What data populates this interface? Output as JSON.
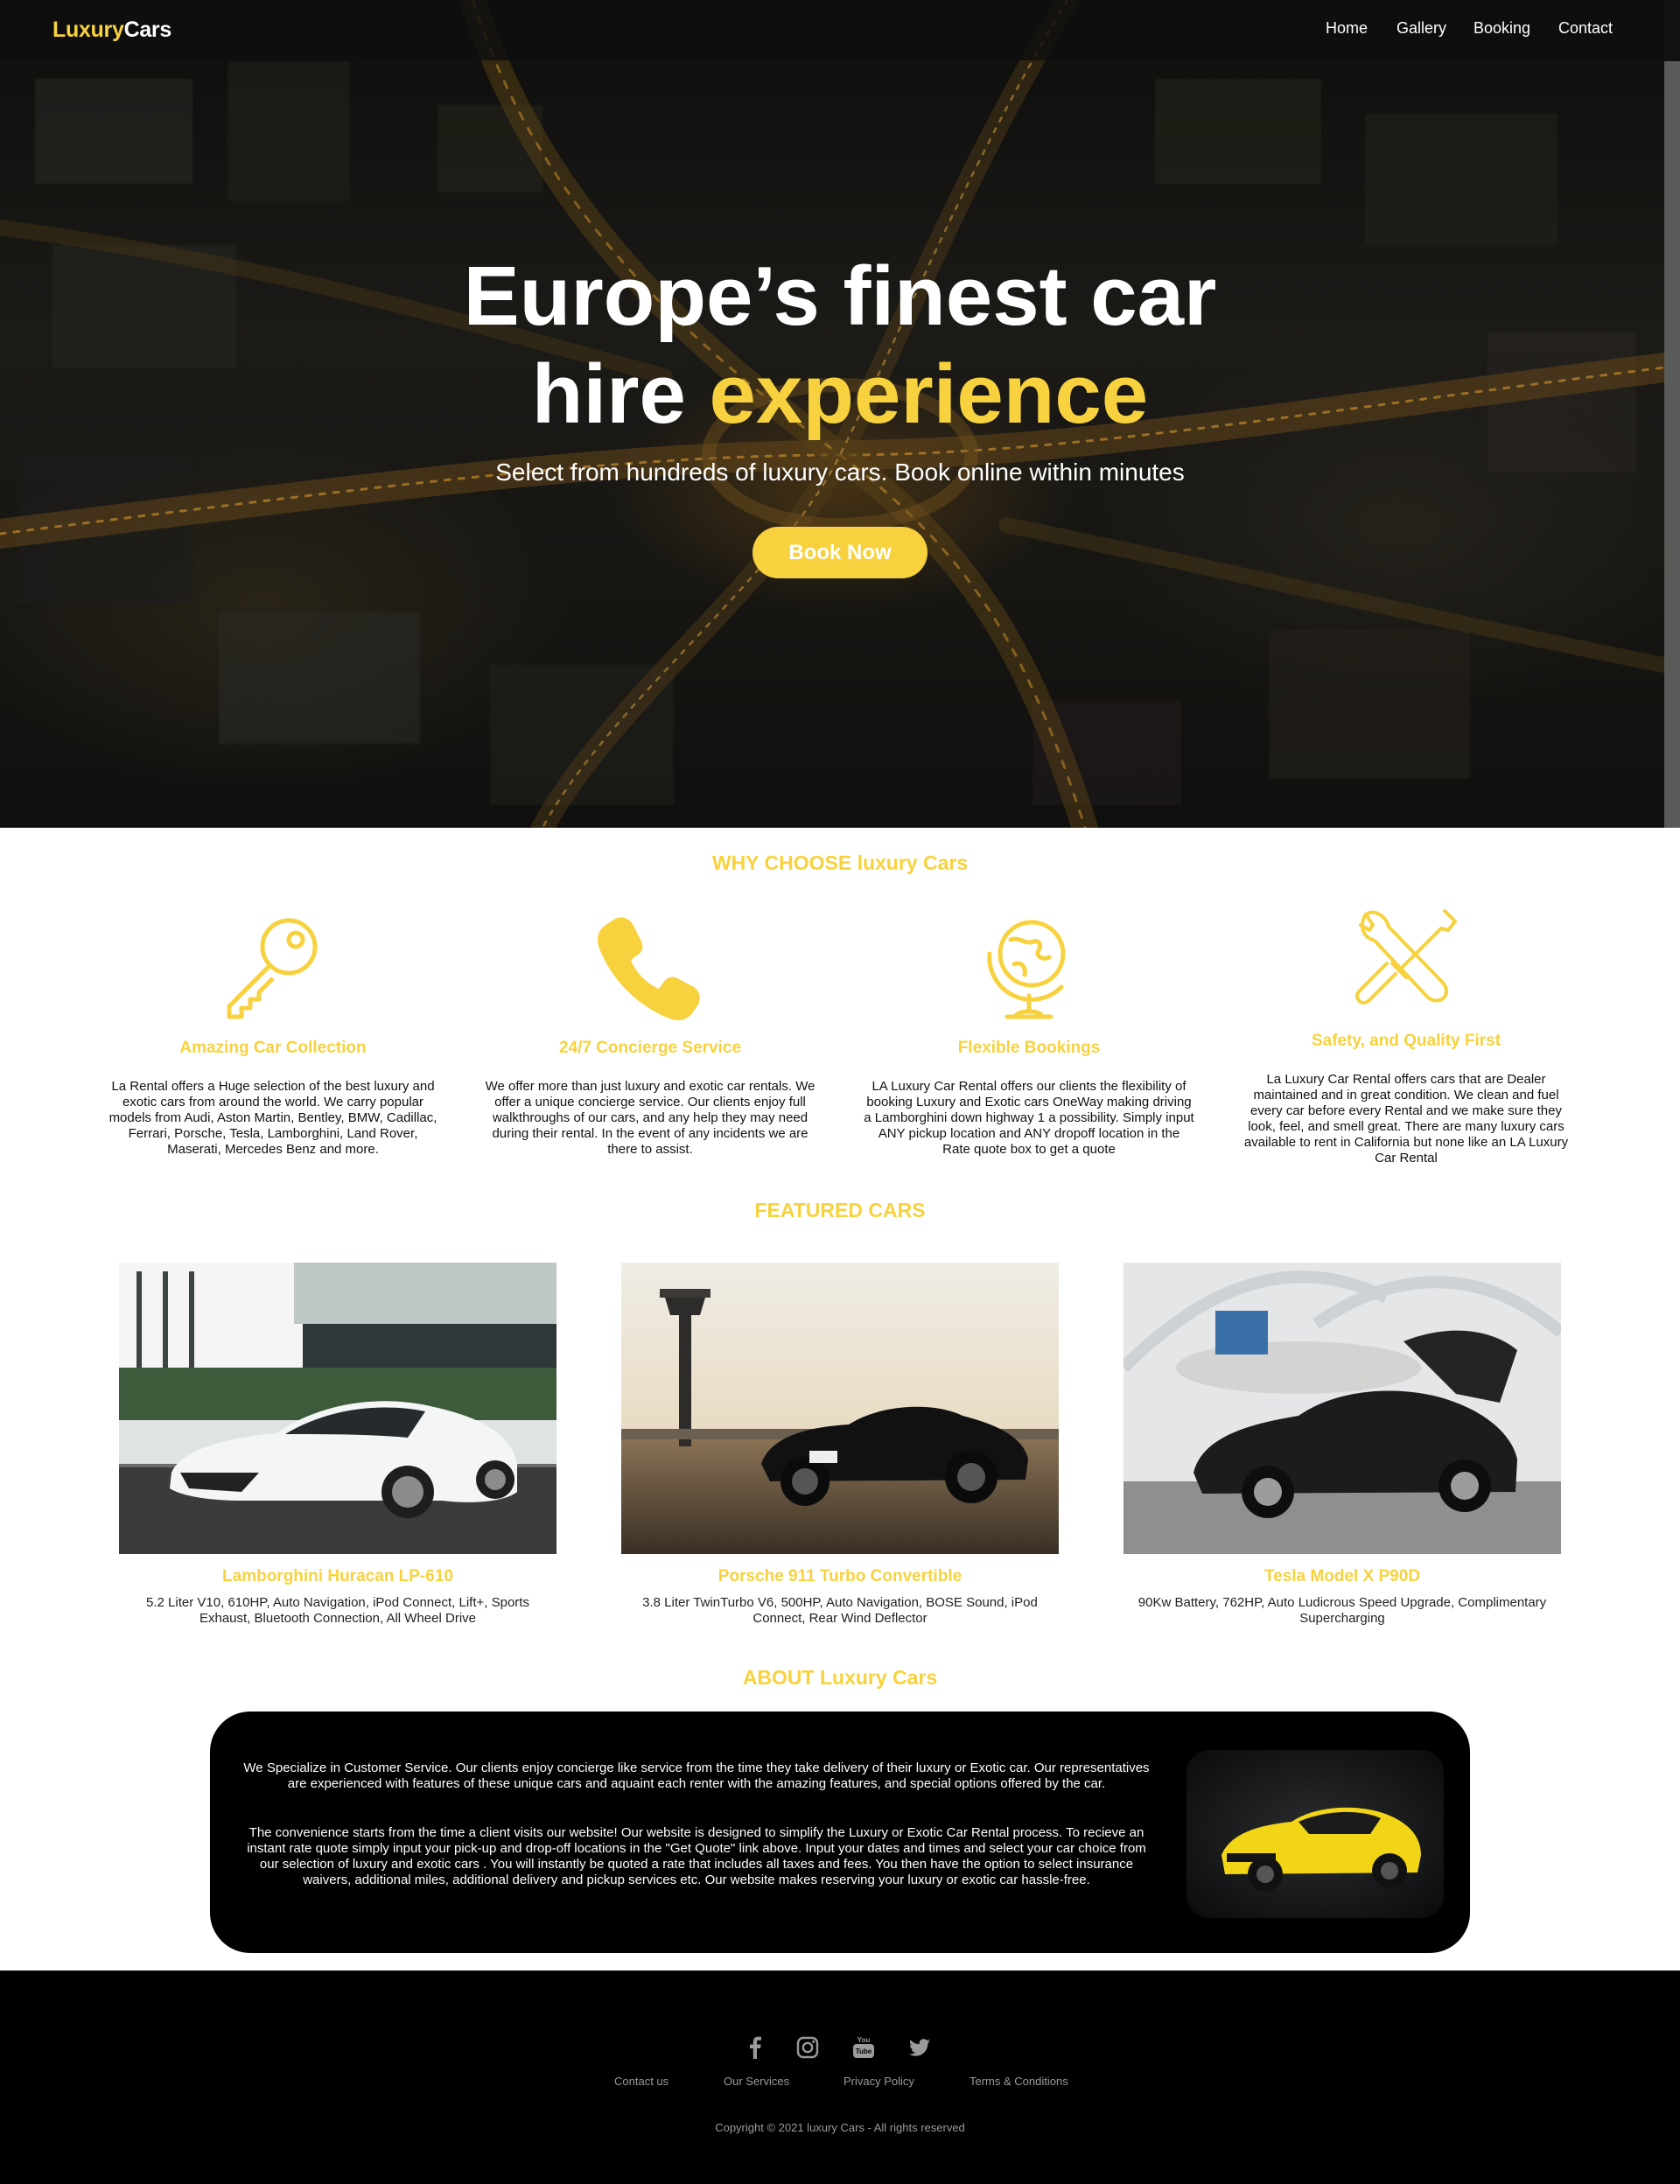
{
  "brand": {
    "part1": "Luxury",
    "part2": "Cars"
  },
  "nav": [
    {
      "label": "Home"
    },
    {
      "label": "Gallery"
    },
    {
      "label": "Booking"
    },
    {
      "label": "Contact"
    }
  ],
  "hero": {
    "line1": "Europe’s finest car",
    "line2_plain": "hire ",
    "line2_highlight": "experience",
    "subtitle": "Select from hundreds of luxury cars. Book online within minutes",
    "cta": "Book Now"
  },
  "why": {
    "title": "WHY CHOOSE luxury Cars",
    "features": [
      {
        "icon": "key-icon",
        "title": "Amazing Car Collection",
        "text": "La Rental offers a Huge selection of the best luxury and exotic cars from around the world. We carry popular models from Audi, Aston Martin, Bentley, BMW, Cadillac, Ferrari, Porsche, Tesla, Lamborghini, Land Rover, Maserati, Mercedes Benz and more."
      },
      {
        "icon": "phone-icon",
        "title": "24/7 Concierge Service",
        "text": "We offer more than just luxury and exotic car rentals. We offer a unique concierge service. Our clients enjoy full walkthroughs of our cars, and any help they may need during their rental. In the event of any incidents we are there to assist."
      },
      {
        "icon": "globe-icon",
        "title": "Flexible Bookings",
        "text": "LA Luxury Car Rental offers our clients the flexibility of booking Luxury and Exotic cars OneWay making driving a Lamborghini down highway 1 a possibility. Simply input ANY pickup location and ANY dropoff location in the Rate quote box to get a quote"
      },
      {
        "icon": "tools-icon",
        "title": "Safety, and Quality First",
        "text": "La Luxury Car Rental offers cars that are Dealer maintained and in great condition. We clean and fuel every car before every Rental and we make sure they look, feel, and smell great. There are many luxury cars available to rent in California but none like an LA Luxury Car Rental"
      }
    ]
  },
  "featured": {
    "title": "FEATURED CARS",
    "cars": [
      {
        "name": "Lamborghini Huracan LP-610",
        "specs": "5.2 Liter V10, 610HP, Auto Navigation, iPod Connect, Lift+, Sports Exhaust, Bluetooth Connection, All Wheel Drive"
      },
      {
        "name": "Porsche 911 Turbo Convertible",
        "specs": "3.8 Liter TwinTurbo V6, 500HP, Auto Navigation, BOSE Sound, iPod Connect, Rear Wind Deflector"
      },
      {
        "name": "Tesla Model X P90D",
        "specs": "90Kw Battery, 762HP, Auto Ludicrous Speed Upgrade, Complimentary Supercharging"
      }
    ]
  },
  "about": {
    "title": "ABOUT Luxury Cars",
    "p1": "We Specialize in Customer Service. Our clients enjoy concierge like service from the time they take delivery of their luxury or Exotic car. Our representatives are experienced with features of these unique cars and aquaint each renter with the amazing features, and special options offered by the car.",
    "p2": "The convenience starts from the time a client visits our website! Our website is designed to simplify the Luxury or Exotic Car Rental process. To recieve an instant rate quote simply input your pick-up and drop-off locations in the \"Get Quote\" link above. Input your dates and times and select your car choice from our selection of luxury and exotic cars . You will instantly be quoted a rate that includes all taxes and fees. You then have the option to select insurance waivers, additional miles, additional delivery and pickup services etc. Our website makes reserving your luxury or exotic car hassle-free."
  },
  "footer": {
    "social": [
      "facebook-icon",
      "instagram-icon",
      "youtube-icon",
      "twitter-icon"
    ],
    "links": [
      {
        "label": "Contact us"
      },
      {
        "label": "Our Services"
      },
      {
        "label": "Privacy Policy"
      },
      {
        "label": "Terms & Conditions"
      }
    ],
    "copyright": "Copyright © 2021 luxury Cars - All rights reserved"
  },
  "colors": {
    "accent": "#f7d23e",
    "dark": "#000000",
    "text": "#111111"
  }
}
